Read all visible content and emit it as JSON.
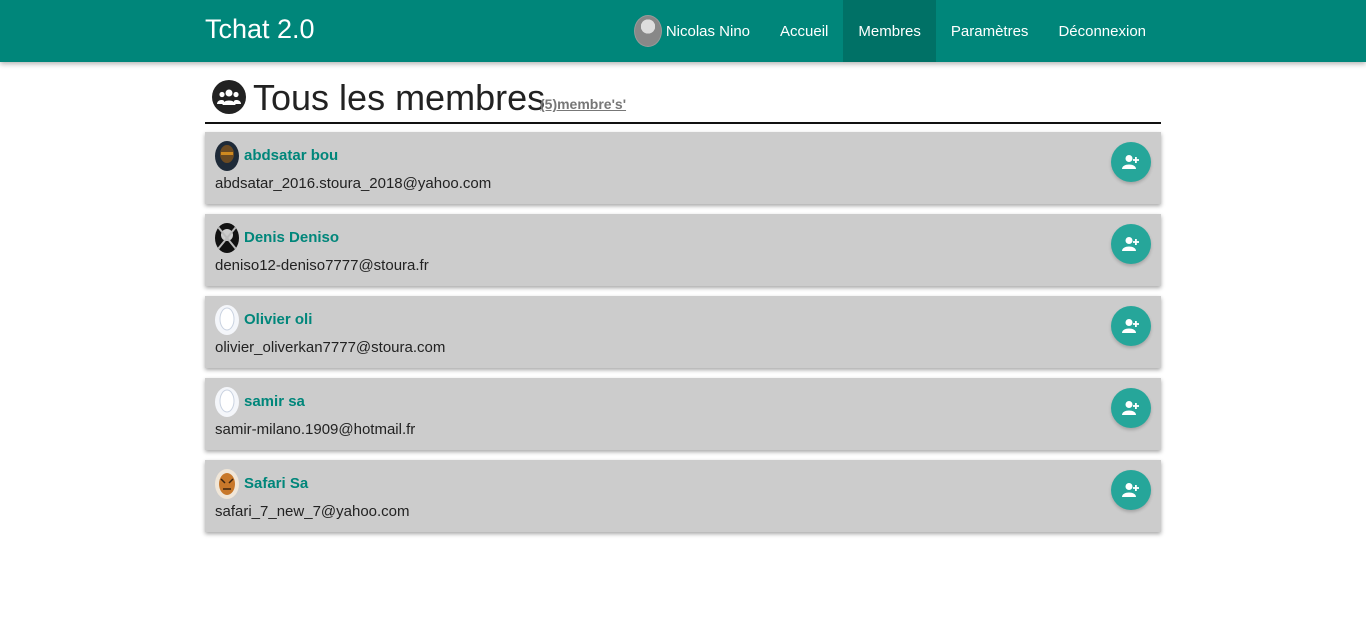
{
  "navbar": {
    "brand": "Tchat 2.0",
    "user_name": "Nicolas Nino",
    "items": [
      {
        "label": "Accueil"
      },
      {
        "label": "Membres"
      },
      {
        "label": "Paramètres"
      },
      {
        "label": "Déconnexion"
      }
    ],
    "active": "Membres",
    "color": "#00867a"
  },
  "page": {
    "title": "Tous les membres",
    "count_label": "(5)membre's'",
    "header_icon": "users-icon"
  },
  "members": [
    {
      "name": "abdsatar bou",
      "email": "abdsatar_2016.stoura_2018@yahoo.com",
      "avatar": "photo-dark"
    },
    {
      "name": "Denis Deniso",
      "email": "deniso12-deniso7777@stoura.fr",
      "avatar": "photo-skull"
    },
    {
      "name": "Olivier oli",
      "email": "olivier_oliverkan7777@stoura.com",
      "avatar": "default-silhouette"
    },
    {
      "name": "samir sa",
      "email": "samir-milano.1909@hotmail.fr",
      "avatar": "default-silhouette"
    },
    {
      "name": "Safari Sa",
      "email": "safari_7_new_7@yahoo.com",
      "avatar": "photo-tiger"
    }
  ],
  "colors": {
    "accent": "#26a69a",
    "card_bg": "#cccccc",
    "name_color": "#00867a"
  },
  "icons": {
    "add_member": "add-user-icon"
  }
}
